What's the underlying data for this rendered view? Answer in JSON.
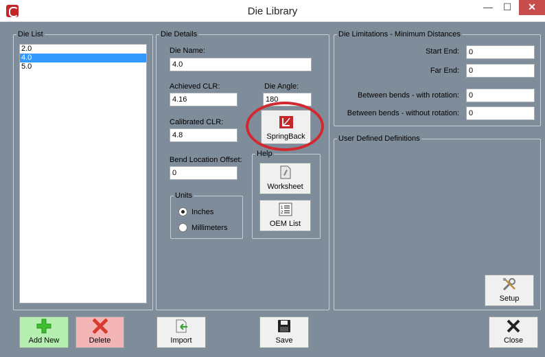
{
  "window": {
    "title": "Die Library",
    "min_glyph": "—",
    "max_glyph": "☐",
    "close_glyph": "✕"
  },
  "die_list": {
    "legend": "Die List",
    "items": [
      "2.0",
      "4.0",
      "5.0"
    ],
    "selected": "4.0"
  },
  "die_details": {
    "legend": "Die Details",
    "die_name_label": "Die Name:",
    "die_name_value": "4.0",
    "achieved_clr_label": "Achieved CLR:",
    "achieved_clr_value": "4.16",
    "die_angle_label": "Die Angle:",
    "die_angle_value": "180",
    "calibrated_clr_label": "Calibrated CLR:",
    "calibrated_clr_value": "4.8",
    "bend_offset_label": "Bend Location Offset:",
    "bend_offset_value": "0",
    "springback_button": "SpringBack",
    "units": {
      "legend": "Units",
      "options": [
        "Inches",
        "Millimeters"
      ],
      "selected": "Inches"
    },
    "help": {
      "legend": "Help",
      "worksheet_button": "Worksheet",
      "oem_button": "OEM List"
    }
  },
  "limitations": {
    "legend": "Die Limitations - Minimum Distances",
    "fields": [
      {
        "label": "Start End:",
        "value": "0"
      },
      {
        "label": "Far End:",
        "value": "0"
      },
      {
        "label": "Between bends - with rotation:",
        "value": "0"
      },
      {
        "label": "Between bends - without rotation:",
        "value": "0"
      }
    ]
  },
  "user_defined": {
    "legend": "User Defined Definitions",
    "setup_button": "Setup"
  },
  "bottom_buttons": {
    "add_new": "Add New",
    "delete": "Delete",
    "import": "Import",
    "save": "Save",
    "close": "Close"
  },
  "colors": {
    "client_bg": "#7f8c99",
    "add_bg": "#b6f0b0",
    "delete_bg": "#f3b5b5",
    "annotation": "#d2282f"
  }
}
